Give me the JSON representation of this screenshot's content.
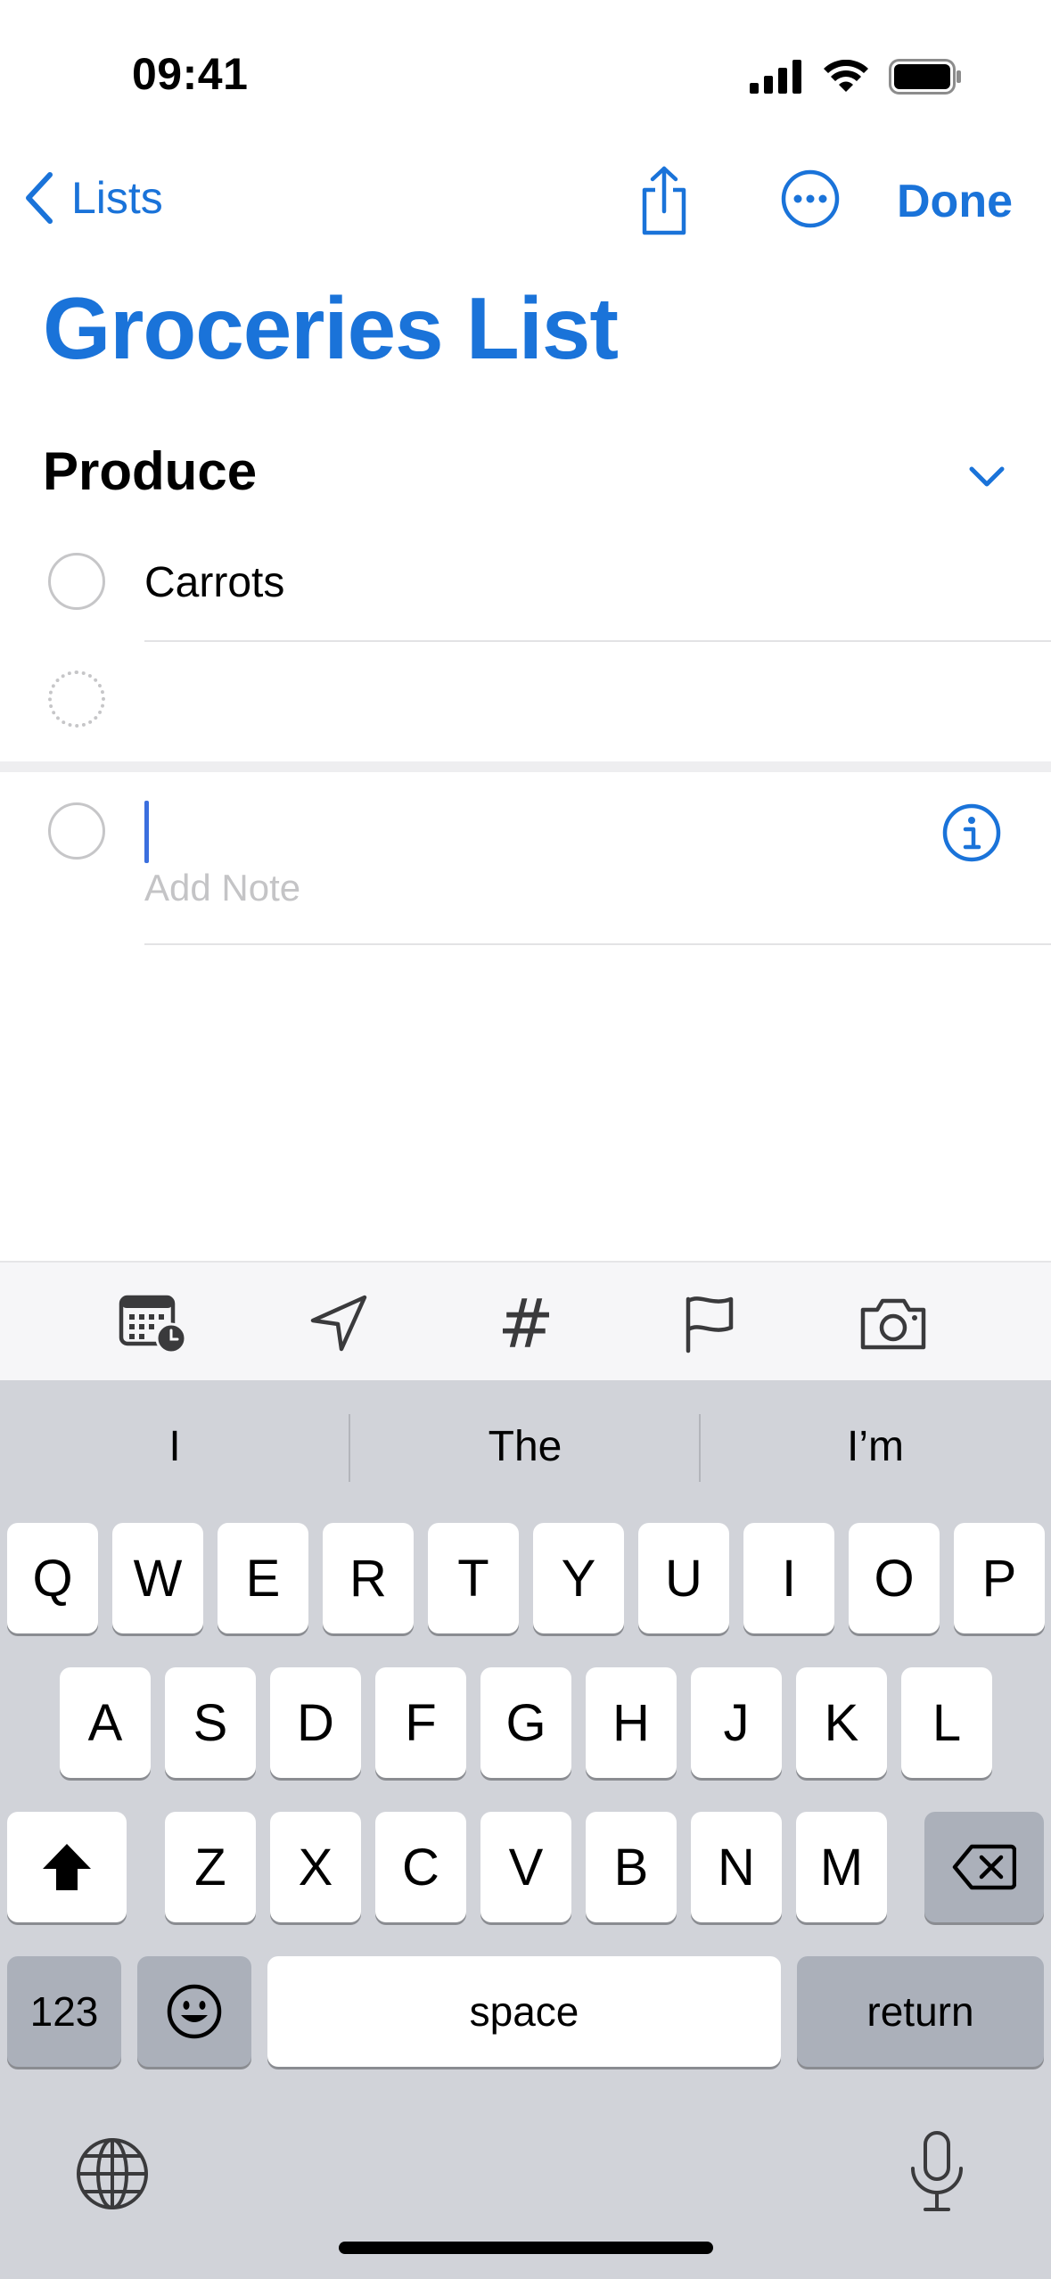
{
  "status": {
    "time": "09:41"
  },
  "nav": {
    "back_label": "Lists",
    "done_label": "Done"
  },
  "list": {
    "title": "Groceries List",
    "section": "Produce",
    "items": [
      {
        "text": "Carrots"
      }
    ],
    "new_item_note_placeholder": "Add Note"
  },
  "toolbar": {
    "icons": [
      "calendar-clock-icon",
      "location-arrow-icon",
      "hashtag-icon",
      "flag-icon",
      "camera-icon"
    ],
    "hashtag_glyph": "#"
  },
  "keyboard": {
    "suggestions": [
      "I",
      "The",
      "I’m"
    ],
    "row1": [
      "Q",
      "W",
      "E",
      "R",
      "T",
      "Y",
      "U",
      "I",
      "O",
      "P"
    ],
    "row2": [
      "A",
      "S",
      "D",
      "F",
      "G",
      "H",
      "J",
      "K",
      "L"
    ],
    "row3": [
      "Z",
      "X",
      "C",
      "V",
      "B",
      "N",
      "M"
    ],
    "numbers_label": "123",
    "space_label": "space",
    "return_label": "return"
  },
  "colors": {
    "accent": "#1a73d9",
    "keyboard_bg": "#d1d3d9",
    "key_dark": "#abb0ba"
  }
}
